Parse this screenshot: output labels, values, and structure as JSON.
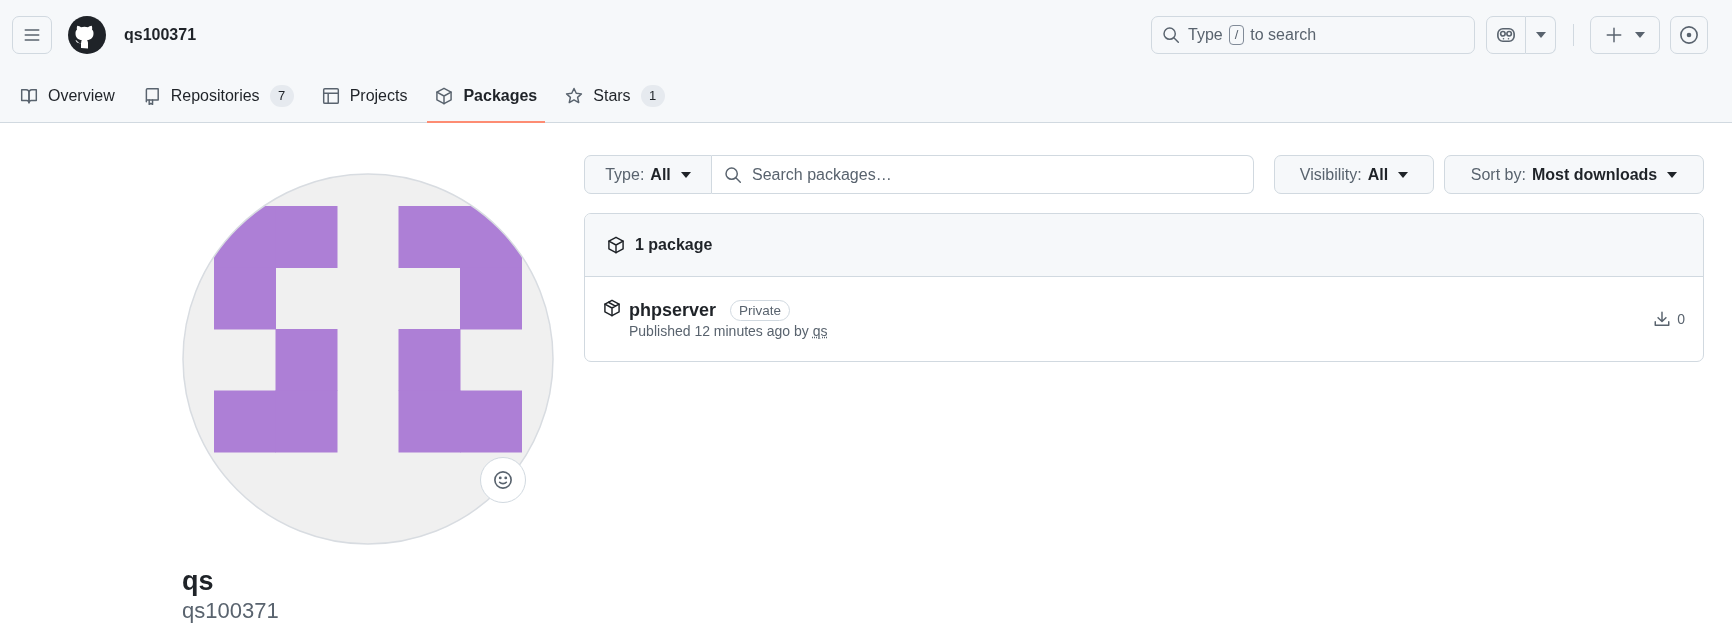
{
  "header": {
    "username": "qs100371",
    "search": {
      "prefix": "Type",
      "key": "/",
      "suffix": "to search"
    }
  },
  "tabs": [
    {
      "kind": "book",
      "label": "Overview",
      "selected": false
    },
    {
      "kind": "repo",
      "label": "Repositories",
      "count": "7",
      "selected": false
    },
    {
      "kind": "table",
      "label": "Projects",
      "selected": false
    },
    {
      "kind": "package",
      "label": "Packages",
      "selected": true
    },
    {
      "kind": "star",
      "label": "Stars",
      "count": "1",
      "selected": false
    }
  ],
  "profile": {
    "name": "qs",
    "login": "qs100371"
  },
  "filters": {
    "type": {
      "label": "Type:",
      "value": "All"
    },
    "search": {
      "placeholder": "Search packages…"
    },
    "visibility": {
      "label": "Visibility:",
      "value": "All"
    },
    "sort": {
      "label": "Sort by:",
      "value": "Most downloads"
    }
  },
  "packages": {
    "summary": "1 package",
    "items": [
      {
        "name": "phpserver",
        "visibility": "Private",
        "published": "Published 12 minutes ago by",
        "author": "qs",
        "downloads": "0"
      }
    ]
  }
}
